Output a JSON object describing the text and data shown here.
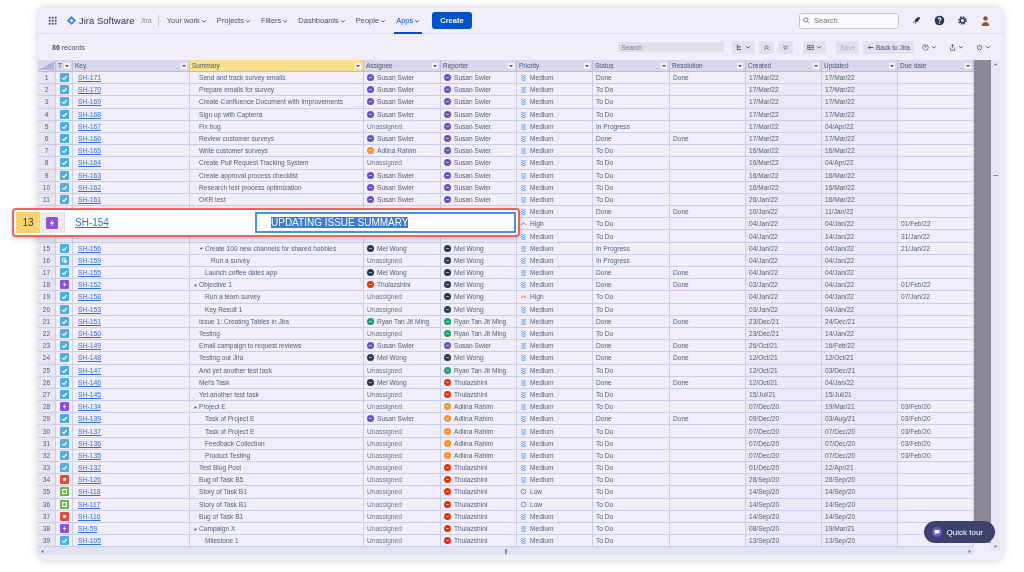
{
  "nav": {
    "app_name": "Jira Software",
    "product": "Jira",
    "items": [
      {
        "label": "Your work",
        "selected": false
      },
      {
        "label": "Projects",
        "selected": false
      },
      {
        "label": "Filters",
        "selected": false
      },
      {
        "label": "Dashboards",
        "selected": false
      },
      {
        "label": "People",
        "selected": false
      },
      {
        "label": "Apps",
        "selected": true
      }
    ],
    "create_button": "Create",
    "search_placeholder": "Search"
  },
  "toolbar": {
    "record_count": "**86** records",
    "search_placeholder": "Search",
    "save_button": {
      "label": "Save",
      "disabled": true
    },
    "back_button": "Back to Jira"
  },
  "table": {
    "columns": [
      {
        "label": "T",
        "selected": false
      },
      {
        "label": "Key",
        "selected": false
      },
      {
        "label": "Summary",
        "selected": true
      },
      {
        "label": "Assignee",
        "selected": false
      },
      {
        "label": "Reporter",
        "selected": false
      },
      {
        "label": "Priority",
        "selected": false
      },
      {
        "label": "Status",
        "selected": false
      },
      {
        "label": "Resolution",
        "selected": false
      },
      {
        "label": "Created",
        "selected": false
      },
      {
        "label": "Updated",
        "selected": false
      },
      {
        "label": "Due date",
        "selected": false
      }
    ],
    "rows": [
      {
        "n": "1",
        "kind": "task",
        "key": "SH-171",
        "summary": "Send and track survey emails",
        "assignee": {
          "name": "Susan Swier",
          "color": "#6554c0"
        },
        "reporter": {
          "name": "Susan Swier",
          "color": "#6554c0"
        },
        "priority": {
          "kind": "medium",
          "label": "Medium"
        },
        "status": "Done",
        "resolution": "Done",
        "created": "17/Mar/22",
        "updated": "17/Mar/22"
      },
      {
        "n": "2",
        "kind": "task",
        "key": "SH-170",
        "summary": "Prepare emails for survey",
        "assignee": {
          "name": "Susan Swier",
          "color": "#6554c0"
        },
        "reporter": {
          "name": "Susan Swier",
          "color": "#6554c0"
        },
        "priority": {
          "kind": "medium",
          "label": "Medium"
        },
        "status": "To Do",
        "created": "17/Mar/22",
        "updated": "17/Mar/22"
      },
      {
        "n": "3",
        "kind": "task",
        "key": "SH-169",
        "summary": "Create Confluence Document with Improvements",
        "overflow_mark": "...",
        "assignee": {
          "name": "Susan Swier",
          "color": "#6554c0"
        },
        "reporter": {
          "name": "Susan Swier",
          "color": "#6554c0"
        },
        "priority": {
          "kind": "medium",
          "label": "Medium"
        },
        "status": "To Do",
        "created": "17/Mar/22",
        "updated": "17/Mar/22"
      },
      {
        "n": "4",
        "kind": "task",
        "key": "SH-168",
        "summary": "Sign up with Capterra",
        "assignee": {
          "name": "Susan Swier",
          "color": "#6554c0"
        },
        "reporter": {
          "name": "Susan Swier",
          "color": "#6554c0"
        },
        "priority": {
          "kind": "medium",
          "label": "Medium"
        },
        "status": "To Do",
        "created": "17/Mar/22",
        "updated": "17/Mar/22"
      },
      {
        "n": "5",
        "kind": "task",
        "key": "SH-167",
        "summary": "Fix bug",
        "assignee": {
          "name": "Unassigned"
        },
        "reporter": {
          "name": "Susan Swier",
          "color": "#6554c0"
        },
        "priority": {
          "kind": "medium",
          "label": "Medium"
        },
        "status": "In Progress",
        "created": "17/Mar/22",
        "updated": "04/Apr/22"
      },
      {
        "n": "6",
        "kind": "task",
        "key": "SH-166",
        "summary": "Review customer surveys",
        "assignee": {
          "name": "Susan Swier",
          "color": "#6554c0"
        },
        "reporter": {
          "name": "Susan Swier",
          "color": "#6554c0"
        },
        "priority": {
          "kind": "medium",
          "label": "Medium"
        },
        "status": "Done",
        "resolution": "Done",
        "created": "17/Mar/22",
        "updated": "17/Mar/22"
      },
      {
        "n": "7",
        "kind": "task",
        "key": "SH-165",
        "summary": "Write customer surveys",
        "assignee": {
          "name": "Adlina Rahim",
          "color": "#f79232"
        },
        "reporter": {
          "name": "Susan Swier",
          "color": "#6554c0"
        },
        "priority": {
          "kind": "medium",
          "label": "Medium"
        },
        "status": "To Do",
        "created": "16/Mar/22",
        "updated": "16/Mar/22"
      },
      {
        "n": "8",
        "kind": "task",
        "key": "SH-164",
        "summary": "Create Pull Request Tracking System",
        "assignee": {
          "name": "Unassigned"
        },
        "reporter": {
          "name": "Susan Swier",
          "color": "#6554c0"
        },
        "priority": {
          "kind": "medium",
          "label": "Medium"
        },
        "status": "To Do",
        "created": "16/Mar/22",
        "updated": "04/Apr/22"
      },
      {
        "n": "9",
        "kind": "task",
        "key": "SH-163",
        "summary": "Create approval process checklist",
        "assignee": {
          "name": "Susan Swier",
          "color": "#6554c0"
        },
        "reporter": {
          "name": "Susan Swier",
          "color": "#6554c0"
        },
        "priority": {
          "kind": "medium",
          "label": "Medium"
        },
        "status": "To Do",
        "created": "16/Mar/22",
        "updated": "16/Mar/22"
      },
      {
        "n": "10",
        "kind": "task",
        "key": "SH-162",
        "summary": "Research test process optimization",
        "assignee": {
          "name": "Susan Swier",
          "color": "#6554c0"
        },
        "reporter": {
          "name": "Susan Swier",
          "color": "#6554c0"
        },
        "priority": {
          "kind": "medium",
          "label": "Medium"
        },
        "status": "To Do",
        "created": "16/Mar/22",
        "updated": "16/Mar/22"
      },
      {
        "n": "11",
        "kind": "task",
        "key": "SH-161",
        "summary": "OKR test",
        "assignee": {
          "name": "Susan Swier",
          "color": "#6554c0"
        },
        "reporter": {
          "name": "Susan Swier",
          "color": "#6554c0"
        },
        "priority": {
          "kind": "medium",
          "label": "Medium"
        },
        "status": "To Do",
        "created": "26/Jan/22",
        "updated": "16/Mar/22"
      },
      {
        "priority": {
          "kind": "medium",
          "label": "Medium"
        },
        "status": "Done",
        "resolution": "Done",
        "created": "10/Jan/22",
        "updated": "11/Jan/22"
      },
      {
        "priority": {
          "kind": "high",
          "label": "High"
        },
        "status": "To Do",
        "created": "04/Jan/22",
        "updated": "04/Jan/22",
        "due": "01/Feb/22",
        "children": [
          {
            "priority": {
              "kind": "medium",
              "label": "Medium"
            },
            "status": "To Do",
            "created": "04/Jan/22",
            "updated": "14/Jan/22",
            "due": "31/Jan/22"
          },
          {
            "n": "15",
            "kind": "task",
            "key": "SH-156",
            "summary": "Create 100 new channels for shared hobbies",
            "expanded": true,
            "assignee": {
              "name": "Mel Wong",
              "color": "#253858"
            },
            "reporter": {
              "name": "Mel Wong",
              "color": "#253858"
            },
            "priority": {
              "kind": "medium",
              "label": "Medium"
            },
            "status": "In Progress",
            "created": "04/Jan/22",
            "updated": "04/Jan/22",
            "due": "21/Jan/22",
            "children": [
              {
                "n": "16",
                "kind": "subtask",
                "key": "SH-159",
                "summary": "Run a survey",
                "assignee": {
                  "name": "Unassigned"
                },
                "reporter": {
                  "name": "Mel Wong",
                  "color": "#253858"
                },
                "priority": {
                  "kind": "medium",
                  "label": "Medium"
                },
                "status": "In Progress",
                "created": "04/Jan/22",
                "updated": "04/Jan/22"
              }
            ]
          },
          {
            "n": "17",
            "kind": "task",
            "key": "SH-155",
            "summary": "Launch coffee dates app",
            "assignee": {
              "name": "Mel Wong",
              "color": "#253858"
            },
            "reporter": {
              "name": "Mel Wong",
              "color": "#253858"
            },
            "priority": {
              "kind": "medium",
              "label": "Medium"
            },
            "status": "Done",
            "resolution": "Done",
            "created": "04/Jan/22",
            "updated": "04/Jan/22"
          }
        ]
      },
      {
        "n": "18",
        "kind": "epic",
        "key": "SH-152",
        "summary": "Objective 1",
        "expanded": true,
        "assignee": {
          "name": "Thulazshini",
          "color": "#de350b"
        },
        "reporter": {
          "name": "Mel Wong",
          "color": "#253858"
        },
        "priority": {
          "kind": "medium",
          "label": "Medium"
        },
        "status": "Done",
        "resolution": "Done",
        "created": "03/Jan/22",
        "updated": "04/Jan/22",
        "due": "01/Feb/22",
        "children": [
          {
            "n": "19",
            "kind": "task",
            "key": "SH-158",
            "summary": "Run a team survey",
            "assignee": {
              "name": "Unassigned"
            },
            "reporter": {
              "name": "Mel Wong",
              "color": "#253858"
            },
            "priority": {
              "kind": "high",
              "label": "High"
            },
            "status": "To Do",
            "created": "04/Jan/22",
            "updated": "04/Jan/22",
            "due": "07/Jan/22"
          },
          {
            "n": "20",
            "kind": "task",
            "key": "SH-153",
            "summary": "Key Result 1",
            "assignee": {
              "name": "Unassigned"
            },
            "reporter": {
              "name": "Mel Wong",
              "color": "#253858"
            },
            "priority": {
              "kind": "medium",
              "label": "Medium"
            },
            "status": "To Do",
            "created": "03/Jan/22",
            "updated": "04/Jan/22"
          }
        ]
      },
      {
        "n": "21",
        "kind": "task",
        "key": "SH-151",
        "summary": "Issue 1: Creating Tables in Jira",
        "assignee": {
          "name": "Ryan Tan Jit Ming",
          "color": "#1f9d74"
        },
        "reporter": {
          "name": "Ryan Tan Jit Ming",
          "color": "#1f9d74"
        },
        "priority": {
          "kind": "medium",
          "label": "Medium"
        },
        "status": "Done",
        "resolution": "Done",
        "created": "23/Dec/21",
        "updated": "24/Dec/21"
      },
      {
        "n": "22",
        "kind": "task",
        "key": "SH-150",
        "summary": "Testing",
        "assignee": {
          "name": "Unassigned"
        },
        "reporter": {
          "name": "Ryan Tan Jit Ming",
          "color": "#1f9d74"
        },
        "priority": {
          "kind": "medium",
          "label": "Medium"
        },
        "status": "To Do",
        "created": "23/Dec/21",
        "updated": "14/Jan/22"
      },
      {
        "n": "23",
        "kind": "task",
        "key": "SH-149",
        "summary": "Email campaign to request reviews",
        "assignee": {
          "name": "Susan Swier",
          "color": "#6554c0"
        },
        "reporter": {
          "name": "Susan Swier",
          "color": "#6554c0"
        },
        "priority": {
          "kind": "medium",
          "label": "Medium"
        },
        "status": "Done",
        "resolution": "Done",
        "created": "26/Oct/21",
        "updated": "16/Feb/22"
      },
      {
        "n": "24",
        "kind": "task",
        "key": "SH-148",
        "summary": "Testing out Jira",
        "assignee": {
          "name": "Mel Wong",
          "color": "#253858"
        },
        "reporter": {
          "name": "Mel Wong",
          "color": "#253858"
        },
        "priority": {
          "kind": "medium",
          "label": "Medium"
        },
        "status": "Done",
        "resolution": "Done",
        "created": "12/Oct/21",
        "updated": "12/Oct/21"
      },
      {
        "n": "25",
        "kind": "task",
        "key": "SH-147",
        "summary": "And yet another test task",
        "assignee": {
          "name": "Unassigned"
        },
        "reporter": {
          "name": "Ryan Tan Jit Ming",
          "color": "#1f9d74"
        },
        "priority": {
          "kind": "medium",
          "label": "Medium"
        },
        "status": "To Do",
        "created": "12/Oct/21",
        "updated": "03/Dec/21"
      },
      {
        "n": "26",
        "kind": "task",
        "key": "SH-146",
        "summary": "Mel's Task",
        "assignee": {
          "name": "Mel Wong",
          "color": "#253858"
        },
        "reporter": {
          "name": "Thulazshini",
          "color": "#de350b"
        },
        "priority": {
          "kind": "medium",
          "label": "Medium"
        },
        "status": "Done",
        "resolution": "Done",
        "created": "12/Oct/21",
        "updated": "04/Jan/22"
      },
      {
        "n": "27",
        "kind": "task",
        "key": "SH-145",
        "summary": "Yet another test task",
        "assignee": {
          "name": "Unassigned"
        },
        "reporter": {
          "name": "Thulazshini",
          "color": "#de350b"
        },
        "priority": {
          "kind": "medium",
          "label": "Medium"
        },
        "status": "To Do",
        "created": "15/Jul/21",
        "updated": "15/Jul/21"
      },
      {
        "n": "28",
        "kind": "epic",
        "key": "SH-134",
        "summary": "Project E",
        "expanded": true,
        "assignee": {
          "name": "Unassigned"
        },
        "reporter": {
          "name": "Adlina Rahim",
          "color": "#f79232"
        },
        "priority": {
          "kind": "medium",
          "label": "Medium"
        },
        "status": "To Do",
        "created": "07/Dec/20",
        "updated": "19/Mar/21",
        "due": "03/Feb/20",
        "children": [
          {
            "n": "29",
            "kind": "task",
            "key": "SH-139",
            "summary": "Task of Project E",
            "assignee": {
              "name": "Susan Swier",
              "color": "#6554c0"
            },
            "reporter": {
              "name": "Adlina Rahim",
              "color": "#f79232"
            },
            "priority": {
              "kind": "medium",
              "label": "Medium"
            },
            "status": "Done",
            "resolution": "Done",
            "created": "09/Dec/20",
            "updated": "03/Aug/21",
            "due": "03/Feb/20"
          },
          {
            "n": "30",
            "kind": "task",
            "key": "SH-137",
            "summary": "Task of Project E",
            "assignee": {
              "name": "Unassigned"
            },
            "reporter": {
              "name": "Adlina Rahim",
              "color": "#f79232"
            },
            "priority": {
              "kind": "medium",
              "label": "Medium"
            },
            "status": "To Do",
            "created": "07/Dec/20",
            "updated": "07/Dec/20",
            "due": "03/Feb/20"
          },
          {
            "n": "31",
            "kind": "task",
            "key": "SH-136",
            "summary": "Feedback Collection",
            "assignee": {
              "name": "Unassigned"
            },
            "reporter": {
              "name": "Adlina Rahim",
              "color": "#f79232"
            },
            "priority": {
              "kind": "medium",
              "label": "Medium"
            },
            "status": "To Do",
            "created": "07/Dec/20",
            "updated": "07/Dec/20",
            "due": "03/Feb/20"
          },
          {
            "n": "32",
            "kind": "task",
            "key": "SH-135",
            "summary": "Product Testing",
            "assignee": {
              "name": "Unassigned"
            },
            "reporter": {
              "name": "Adlina Rahim",
              "color": "#f79232"
            },
            "priority": {
              "kind": "medium",
              "label": "Medium"
            },
            "status": "To Do",
            "created": "07/Dec/20",
            "updated": "07/Dec/20",
            "due": "03/Feb/20"
          }
        ]
      },
      {
        "n": "33",
        "kind": "task",
        "key": "SH-132",
        "summary": "Test Blog Post",
        "assignee": {
          "name": "Unassigned"
        },
        "reporter": {
          "name": "Thulazshini",
          "color": "#de350b"
        },
        "priority": {
          "kind": "medium",
          "label": "Medium"
        },
        "status": "To Do",
        "created": "01/Dec/20",
        "updated": "12/Apr/21"
      },
      {
        "n": "34",
        "kind": "bug",
        "key": "SH-126",
        "summary": "Bug of Task B5",
        "assignee": {
          "name": "Unassigned"
        },
        "reporter": {
          "name": "Thulazshini",
          "color": "#de350b"
        },
        "priority": {
          "kind": "medium",
          "label": "Medium"
        },
        "status": "To Do",
        "created": "28/Sep/20",
        "updated": "28/Sep/20"
      },
      {
        "n": "35",
        "kind": "story",
        "key": "SH-118",
        "summary": "Story of Task B1",
        "assignee": {
          "name": "Unassigned"
        },
        "reporter": {
          "name": "Thulazshini",
          "color": "#de350b"
        },
        "priority": {
          "kind": "low",
          "label": "Low"
        },
        "status": "To Do",
        "created": "14/Sep/20",
        "updated": "14/Sep/20"
      },
      {
        "n": "36",
        "kind": "story",
        "key": "SH-117",
        "summary": "Story of Task B1",
        "assignee": {
          "name": "Unassigned"
        },
        "reporter": {
          "name": "Thulazshini",
          "color": "#de350b"
        },
        "priority": {
          "kind": "low",
          "label": "Low"
        },
        "status": "To Do",
        "created": "14/Sep/20",
        "updated": "14/Sep/20"
      },
      {
        "n": "37",
        "kind": "bug",
        "key": "SH-116",
        "summary": "Bug of Task B1",
        "assignee": {
          "name": "Unassigned"
        },
        "reporter": {
          "name": "Thulazshini",
          "color": "#de350b"
        },
        "priority": {
          "kind": "medium",
          "label": "Medium"
        },
        "status": "To Do",
        "created": "14/Sep/20",
        "updated": "14/Sep/20"
      },
      {
        "n": "38",
        "kind": "epic",
        "key": "SH-59",
        "summary": "Campaign X",
        "expanded": true,
        "assignee": {
          "name": "Unassigned"
        },
        "reporter": {
          "name": "Thulazshini",
          "color": "#de350b"
        },
        "priority": {
          "kind": "medium",
          "label": "Medium"
        },
        "status": "To Do",
        "created": "08/Sep/20",
        "updated": "19/Mar/21",
        "children": [
          {
            "n": "39",
            "kind": "task",
            "key": "SH-105",
            "summary": "Milestone 1",
            "assignee": {
              "name": "Unassigned"
            },
            "reporter": {
              "name": "Thulazshini",
              "color": "#de350b"
            },
            "priority": {
              "kind": "medium",
              "label": "Medium"
            },
            "status": "To Do",
            "created": "13/Sep/20",
            "updated": "13/Sep/20"
          }
        ]
      }
    ]
  },
  "editing_row": {
    "number": "13",
    "kind": "epic",
    "key": "SH-154",
    "value": "UPDATING ISSUE SUMMARY"
  },
  "quick_tour_button": "Quick tour"
}
